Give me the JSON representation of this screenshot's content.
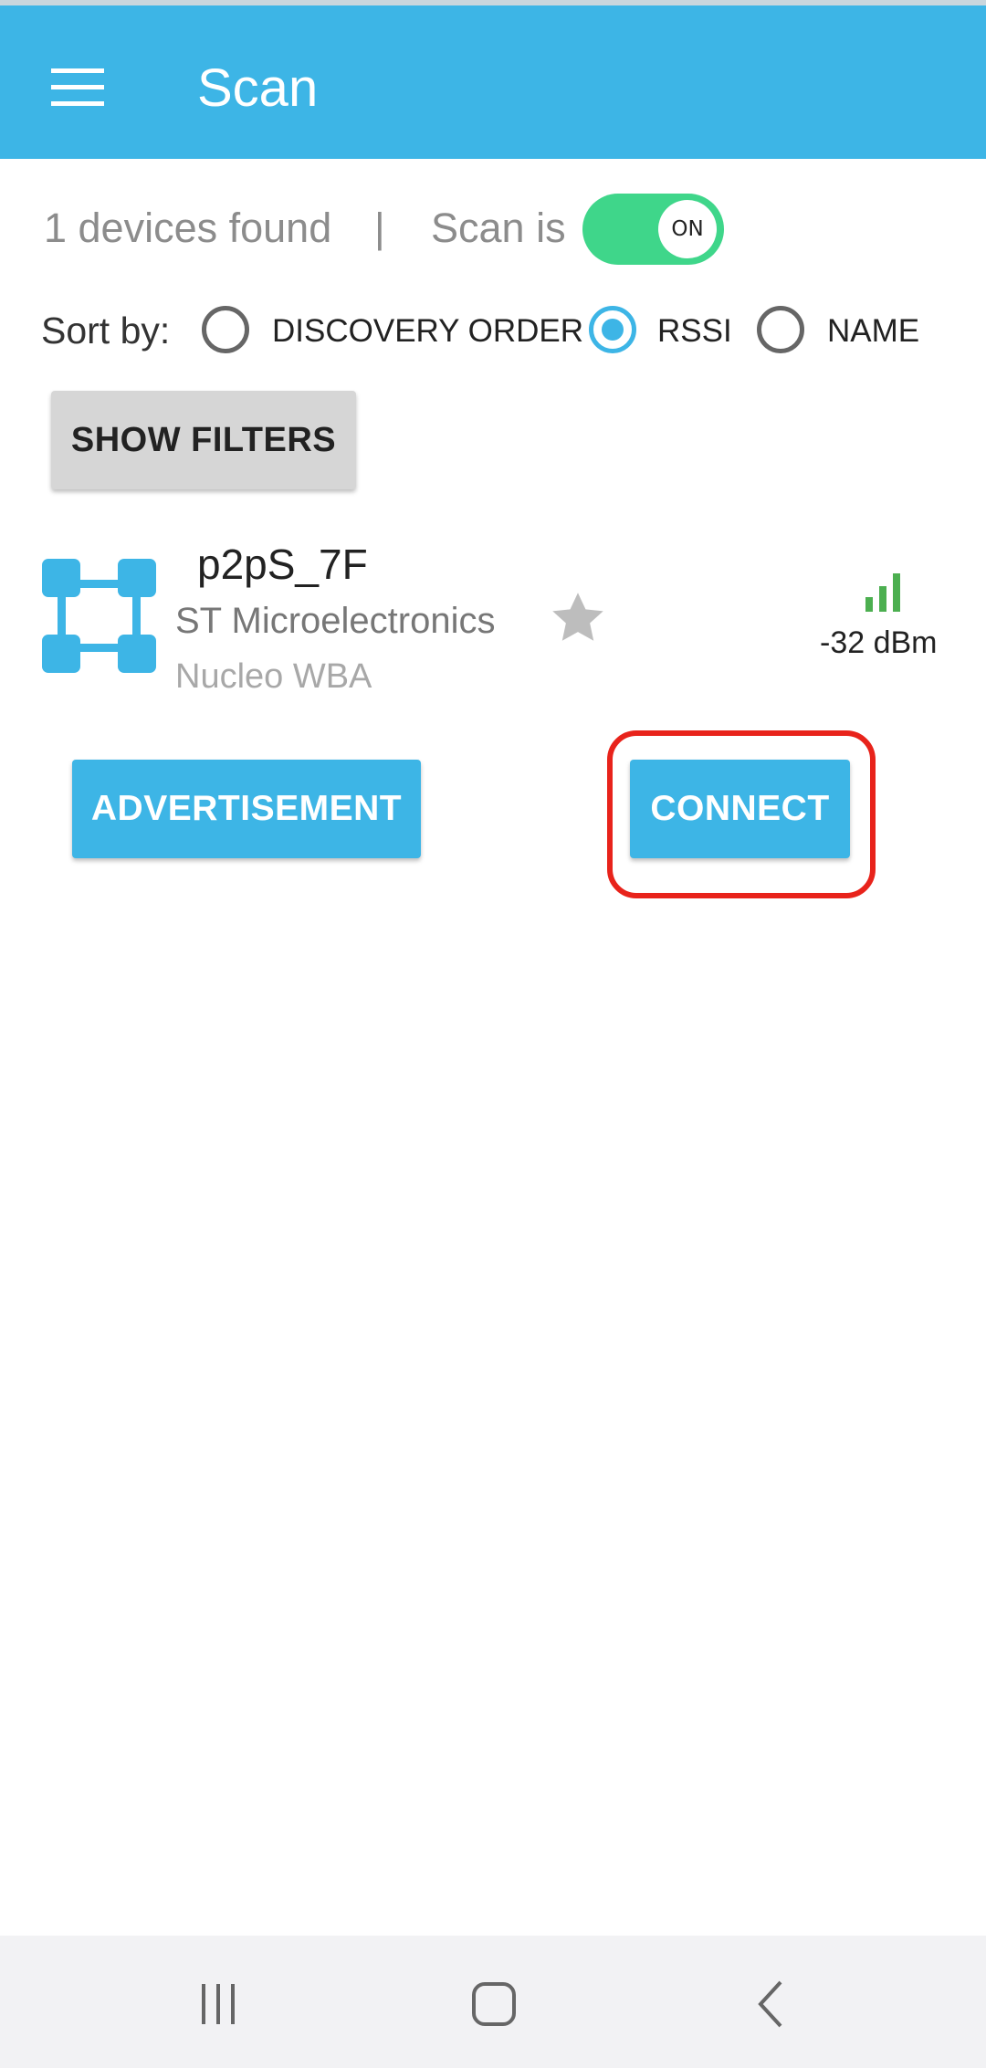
{
  "app_bar": {
    "title": "Scan",
    "menu_icon": "hamburger-menu-icon",
    "background": "#3db5e6"
  },
  "scan_status": {
    "devices_found": "1 devices found",
    "separator": "|",
    "scan_label": "Scan is",
    "toggle_state": "ON",
    "toggle_color": "#3fd68a"
  },
  "sort": {
    "label": "Sort by:",
    "options": [
      {
        "label": "DISCOVERY ORDER",
        "selected": false
      },
      {
        "label": "RSSI",
        "selected": true
      },
      {
        "label": "NAME",
        "selected": false
      }
    ]
  },
  "filters": {
    "button_label": "SHOW FILTERS"
  },
  "device": {
    "name": "p2pS_7F",
    "manufacturer": "ST Microelectronics",
    "model": "Nucleo WBA",
    "rssi": "-32 dBm",
    "icon": "board-nodes-icon",
    "favorite_icon": "star-icon",
    "signal_icon": "signal-bars-icon",
    "signal_color": "#4caf50",
    "advertisement_label": "ADVERTISEMENT",
    "connect_label": "CONNECT"
  },
  "highlight_color": "#e8231b",
  "nav_bar": {
    "recents_icon": "recent-apps-icon",
    "home_icon": "home-icon",
    "back_icon": "back-icon"
  }
}
